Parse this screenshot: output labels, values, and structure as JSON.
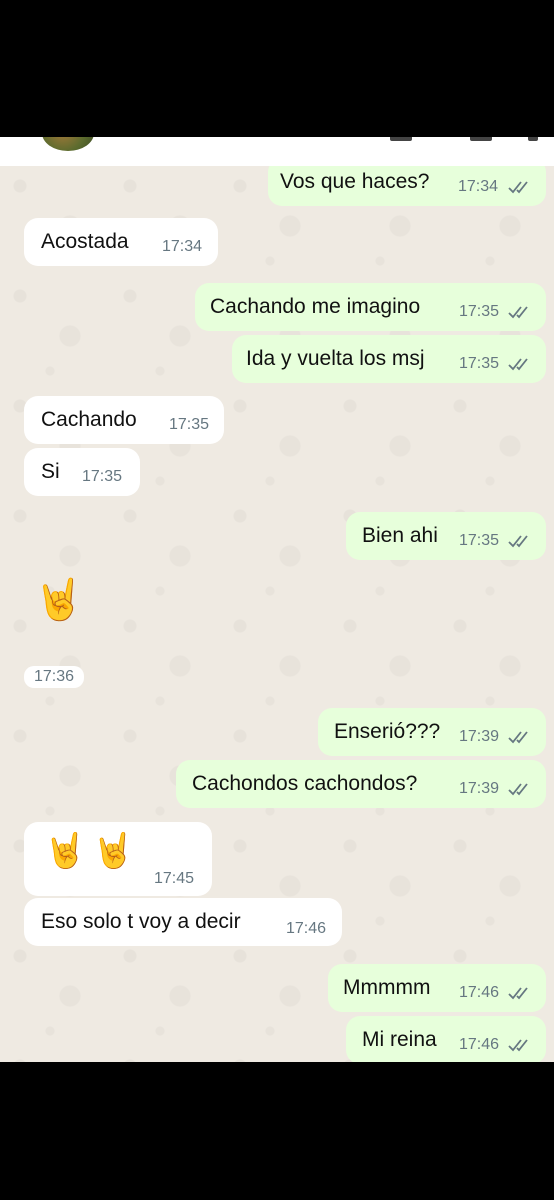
{
  "messages": [
    {
      "dir": "out",
      "text": "Vos que haces?",
      "time": "17:34"
    },
    {
      "dir": "in",
      "text": "Acostada",
      "time": "17:34"
    },
    {
      "dir": "out",
      "text": "Cachando me imagino",
      "time": "17:35"
    },
    {
      "dir": "out",
      "text": "Ida y vuelta los msj",
      "time": "17:35"
    },
    {
      "dir": "in",
      "text": "Cachando",
      "time": "17:35"
    },
    {
      "dir": "in",
      "text": "Si",
      "time": "17:35"
    },
    {
      "dir": "out",
      "text": "Bien ahi",
      "time": "17:35"
    },
    {
      "dir": "in",
      "text": "🤘",
      "time": "17:36"
    },
    {
      "dir": "out",
      "text": "Enserió???",
      "time": "17:39"
    },
    {
      "dir": "out",
      "text": "Cachondos cachondos?",
      "time": "17:39"
    },
    {
      "dir": "in",
      "text": "🤘🤘",
      "time": "17:45"
    },
    {
      "dir": "in",
      "text": "Eso solo t voy a decir",
      "time": "17:46"
    },
    {
      "dir": "out",
      "text": "Mmmmm",
      "time": "17:46"
    },
    {
      "dir": "out",
      "text": "Mi reina",
      "time": "17:46"
    }
  ],
  "icons": {
    "read_receipt": "double-check-icon",
    "contact_avatar": "avatar"
  },
  "colors": {
    "incoming": "#ffffff",
    "outgoing": "#e7ffdb",
    "chat_background": "#efeae2",
    "ticks": "#667781"
  }
}
